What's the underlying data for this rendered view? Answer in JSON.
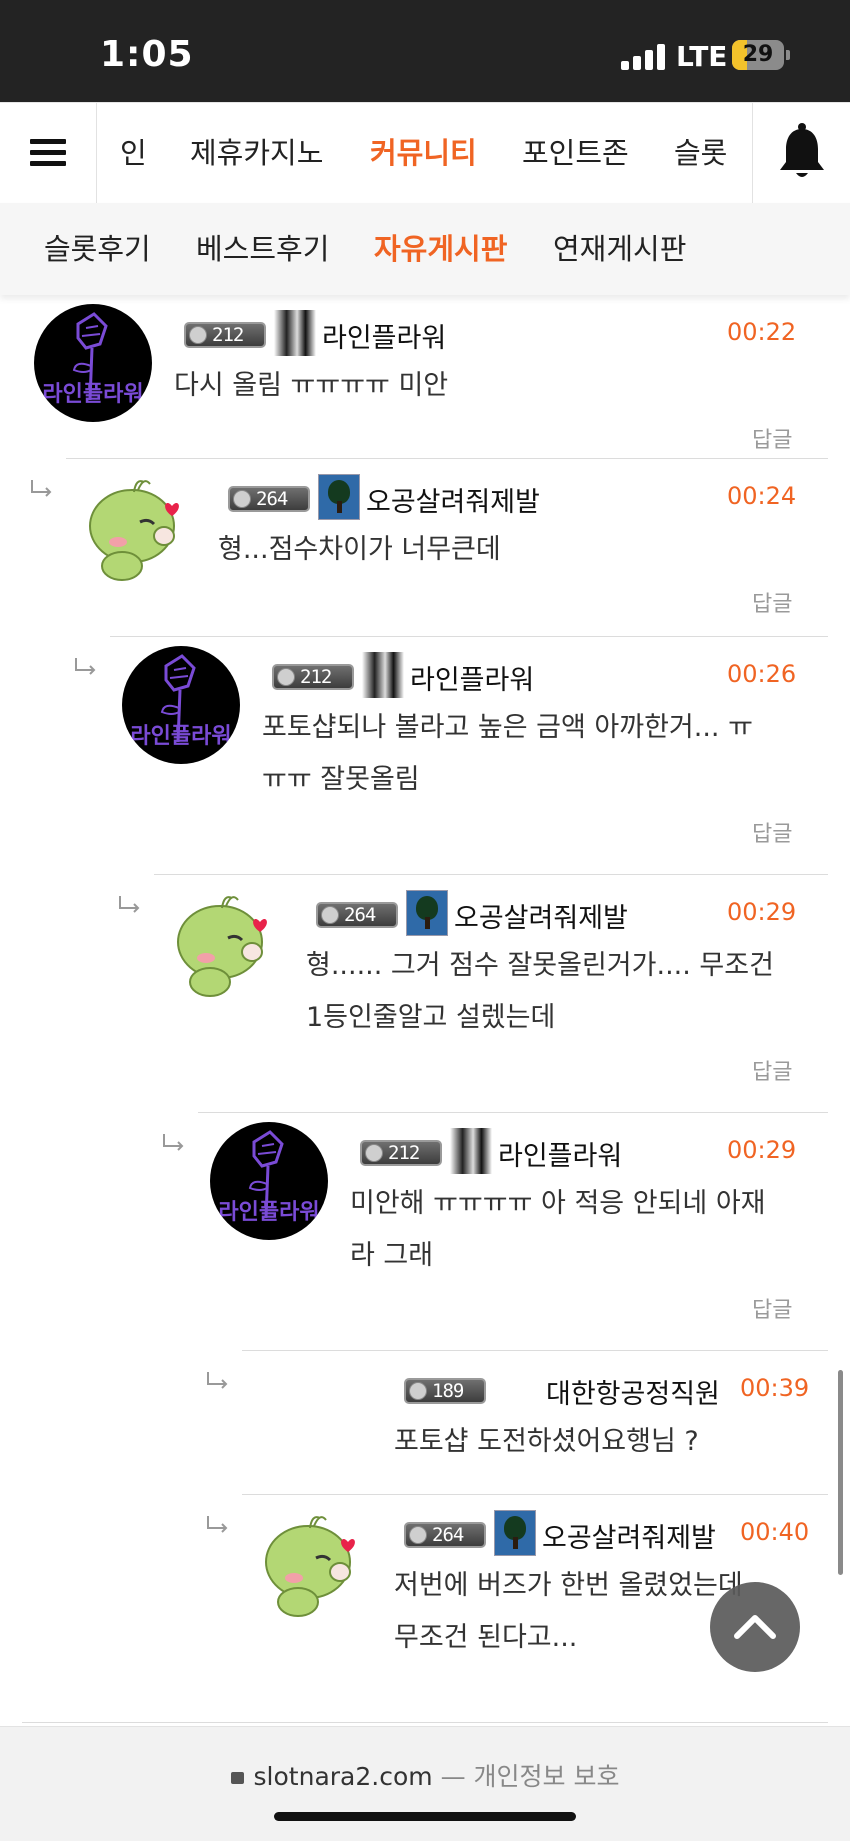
{
  "status_bar": {
    "time": "1:05",
    "network": "LTE",
    "battery": "29",
    "battery_level": 0.29
  },
  "nav": {
    "items": [
      "인",
      "제휴카지노",
      "커뮤니티",
      "포인트존",
      "슬롯"
    ],
    "active": "커뮤니티"
  },
  "subnav": {
    "items": [
      "슬롯후기",
      "베스트후기",
      "자유게시판",
      "연재게시판"
    ],
    "active": "자유게시판"
  },
  "avatar_text": "라인플라워",
  "reply_label": "답글",
  "comments": [
    {
      "level": "212",
      "nickname": "라인플라워",
      "time": "00:22",
      "text_lines": [
        "다시 올림 ㅠㅠㅠㅠ  미안"
      ],
      "avatar": "flower",
      "icon": "bw"
    },
    {
      "level": "264",
      "nickname": "오공살려줘제발",
      "time": "00:24",
      "text_lines": [
        "형...점수차이가 너무큰데"
      ],
      "avatar": "bird",
      "icon": "tree"
    },
    {
      "level": "212",
      "nickname": "라인플라워",
      "time": "00:26",
      "text_lines": [
        "포토샵되나 볼라고 높은 금액 아까한거...  ㅠ",
        "ㅠㅠ 잘못올림"
      ],
      "avatar": "flower",
      "icon": "bw"
    },
    {
      "level": "264",
      "nickname": "오공살려줘제발",
      "time": "00:29",
      "text_lines": [
        "형...... 그거 점수 잘못올린거가.... 무조건",
        "1등인줄알고 설렜는데"
      ],
      "avatar": "bird",
      "icon": "tree"
    },
    {
      "level": "212",
      "nickname": "라인플라워",
      "time": "00:29",
      "text_lines": [
        "미안해 ㅠㅠㅠㅠ 아 적응 안되네 아재",
        "라 그래"
      ],
      "avatar": "flower",
      "icon": "bw"
    },
    {
      "level": "189",
      "nickname": "대한항공정직원",
      "time": "00:39",
      "text_lines": [
        "포토샵 도전하셨어요행님 ?"
      ],
      "avatar": "none",
      "icon": "none"
    },
    {
      "level": "264",
      "nickname": "오공살려줘제발",
      "time": "00:40",
      "text_lines": [
        "저번에 버즈가 한번 올렸었는데",
        "무조건 된다고..."
      ],
      "avatar": "bird",
      "icon": "tree"
    }
  ],
  "browser": {
    "url": "slotnara2.com",
    "separator": "—",
    "privacy": "개인정보 보호"
  }
}
